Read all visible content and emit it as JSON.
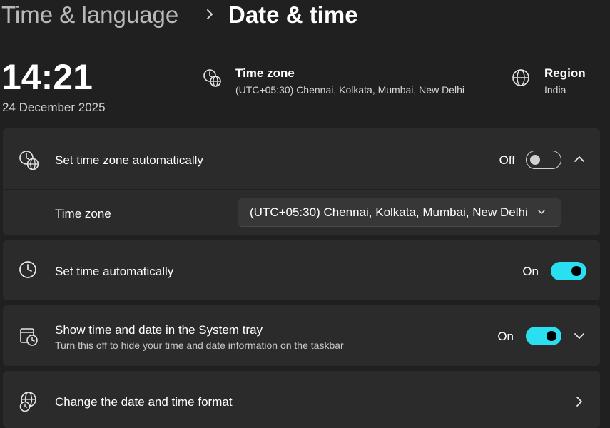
{
  "breadcrumb": {
    "parent": "Time & language",
    "current": "Date & time"
  },
  "clock": {
    "time": "14:21",
    "date": "24 December 2025"
  },
  "time_zone_info": {
    "title": "Time zone",
    "value": "(UTC+05:30) Chennai, Kolkata, Mumbai, New Delhi"
  },
  "region_info": {
    "title": "Region",
    "value": "India"
  },
  "set_time_zone_auto": {
    "label": "Set time zone automatically",
    "state_label": "Off",
    "enabled": false
  },
  "time_zone_setting": {
    "label": "Time zone",
    "selected": "(UTC+05:30) Chennai, Kolkata, Mumbai, New Delhi"
  },
  "set_time_auto": {
    "label": "Set time automatically",
    "state_label": "On",
    "enabled": true
  },
  "show_in_tray": {
    "label": "Show time and date in the System tray",
    "description": "Turn this off to hide your time and date information on the taskbar",
    "state_label": "On",
    "enabled": true
  },
  "date_format": {
    "label": "Change the date and time format"
  },
  "colors": {
    "background": "#202020",
    "card": "#2b2b2b",
    "accent": "#29dff0"
  }
}
